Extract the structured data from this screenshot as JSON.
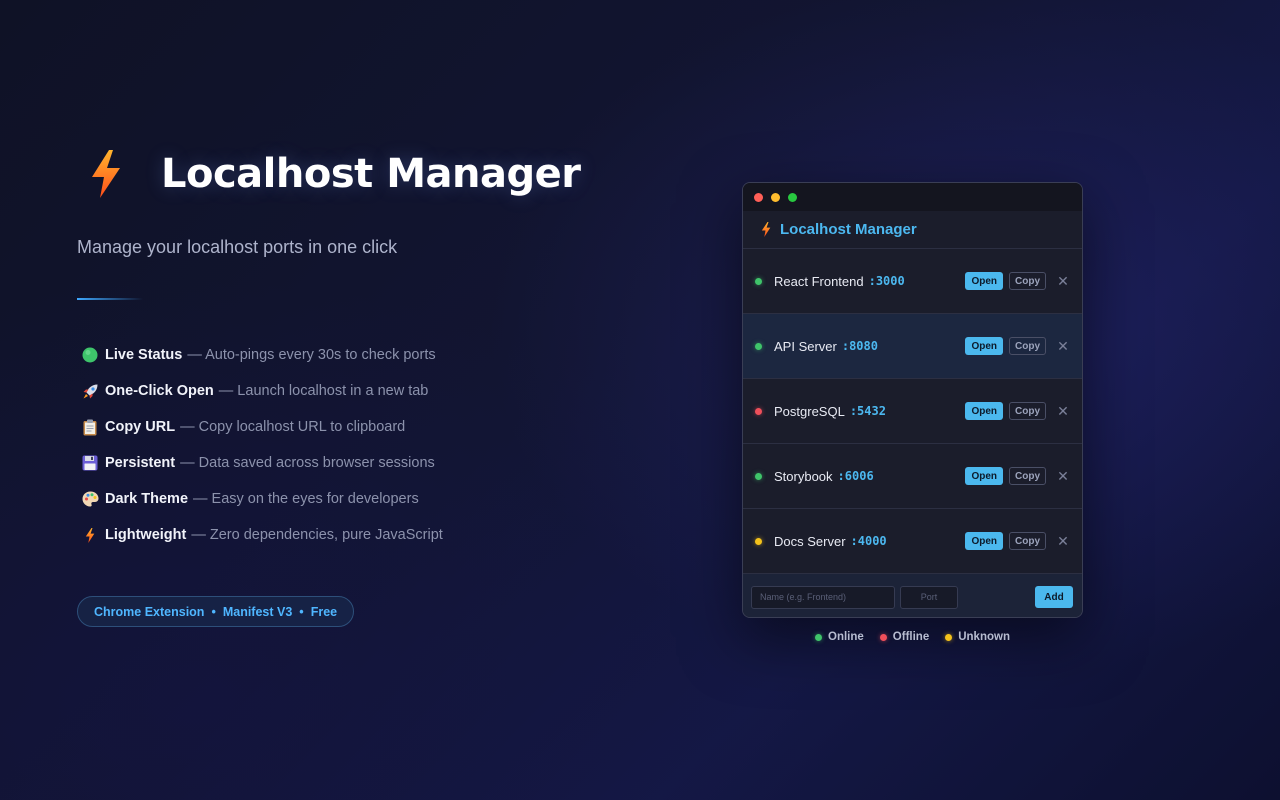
{
  "hero": {
    "title": "Localhost Manager",
    "subtitle": "Manage your localhost ports in one click",
    "features": [
      {
        "icon": "green-circle-icon",
        "title": "Live Status",
        "desc": "— Auto-pings every 30s to check ports"
      },
      {
        "icon": "rocket-icon",
        "title": "One-Click Open",
        "desc": "— Launch localhost in a new tab"
      },
      {
        "icon": "clipboard-icon",
        "title": "Copy URL",
        "desc": "— Copy localhost URL to clipboard"
      },
      {
        "icon": "floppy-disk-icon",
        "title": "Persistent",
        "desc": "— Data saved across browser sessions"
      },
      {
        "icon": "palette-icon",
        "title": "Dark Theme",
        "desc": "— Easy on the eyes for developers"
      },
      {
        "icon": "lightning-icon",
        "title": "Lightweight",
        "desc": "— Zero dependencies, pure JavaScript"
      }
    ],
    "badge": {
      "part1": "Chrome Extension",
      "sep": "•",
      "part2": "Manifest V3",
      "part3": "Free"
    }
  },
  "popup": {
    "title": "Localhost Manager",
    "services": [
      {
        "name": "React Frontend",
        "port": ":3000",
        "status": "online"
      },
      {
        "name": "API Server",
        "port": ":8080",
        "status": "online"
      },
      {
        "name": "PostgreSQL",
        "port": ":5432",
        "status": "offline"
      },
      {
        "name": "Storybook",
        "port": ":6006",
        "status": "online"
      },
      {
        "name": "Docs Server",
        "port": ":4000",
        "status": "unknown"
      }
    ],
    "open_label": "Open",
    "copy_label": "Copy",
    "remove_label": "✕",
    "add": {
      "name_placeholder": "Name (e.g. Frontend)",
      "port_placeholder": "Port",
      "button_label": "Add"
    }
  },
  "legend": {
    "online": "Online",
    "offline": "Offline",
    "unknown": "Unknown"
  },
  "colors": {
    "accent": "#4bb8ee",
    "online": "#3fc46a",
    "offline": "#ef4f5a",
    "unknown": "#f4c21b",
    "bolt_top": "#ffb52e",
    "bolt_bottom": "#ff5a1f"
  }
}
